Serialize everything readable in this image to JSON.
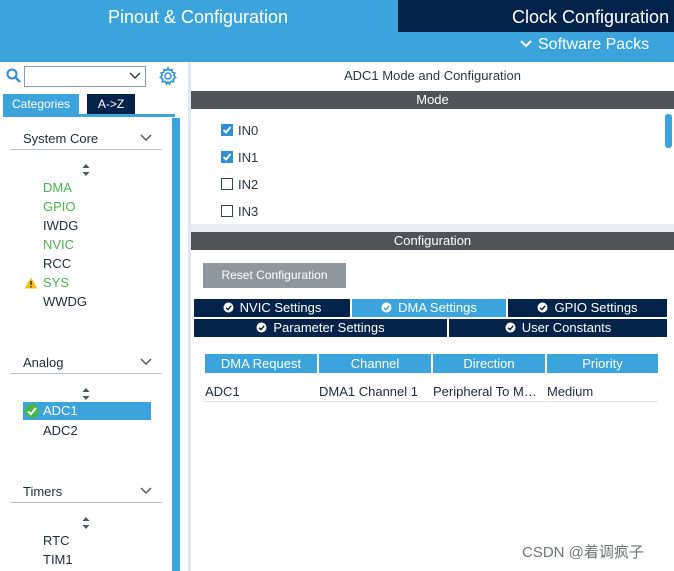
{
  "top_tabs": {
    "pinout": "Pinout & Configuration",
    "clock": "Clock Configuration",
    "software_packs": "Software Packs"
  },
  "left_panel": {
    "search": {
      "value": "",
      "placeholder": ""
    },
    "tabs": {
      "categories": "Categories",
      "az": "A->Z"
    },
    "sections": {
      "system_core": {
        "title": "System Core",
        "items": [
          {
            "label": "DMA",
            "status": "configured"
          },
          {
            "label": "GPIO",
            "status": "configured"
          },
          {
            "label": "IWDG",
            "status": "normal"
          },
          {
            "label": "NVIC",
            "status": "configured"
          },
          {
            "label": "RCC",
            "status": "normal"
          },
          {
            "label": "SYS",
            "status": "warning"
          },
          {
            "label": "WWDG",
            "status": "normal"
          }
        ]
      },
      "analog": {
        "title": "Analog",
        "items": [
          {
            "label": "ADC1",
            "status": "selected"
          },
          {
            "label": "ADC2",
            "status": "normal"
          }
        ]
      },
      "timers": {
        "title": "Timers",
        "items": [
          {
            "label": "RTC",
            "status": "normal"
          },
          {
            "label": "TIM1",
            "status": "normal"
          }
        ]
      }
    }
  },
  "main": {
    "title": "ADC1 Mode and Configuration",
    "mode_header": "Mode",
    "mode_items": [
      {
        "label": "IN0",
        "checked": true
      },
      {
        "label": "IN1",
        "checked": true
      },
      {
        "label": "IN2",
        "checked": false
      },
      {
        "label": "IN3",
        "checked": false
      }
    ],
    "config_header": "Configuration",
    "reset_button": "Reset Configuration",
    "tabs": [
      {
        "label": "NVIC Settings",
        "active": false
      },
      {
        "label": "DMA Settings",
        "active": true
      },
      {
        "label": "GPIO Settings",
        "active": false
      },
      {
        "label": "Parameter Settings",
        "active": false
      },
      {
        "label": "User Constants",
        "active": false
      }
    ],
    "dma_table": {
      "columns": [
        "DMA Request",
        "Channel",
        "Direction",
        "Priority"
      ],
      "rows": [
        [
          "ADC1",
          "DMA1 Channel 1",
          "Peripheral To Memory",
          "Medium"
        ]
      ]
    }
  },
  "watermark": "CSDN @着调疯子",
  "colors": {
    "accent": "#3ba4dd",
    "navy": "#03234b",
    "configured_green": "#47b547",
    "dark_bar": "#505458",
    "warning": "#f2c21a"
  }
}
